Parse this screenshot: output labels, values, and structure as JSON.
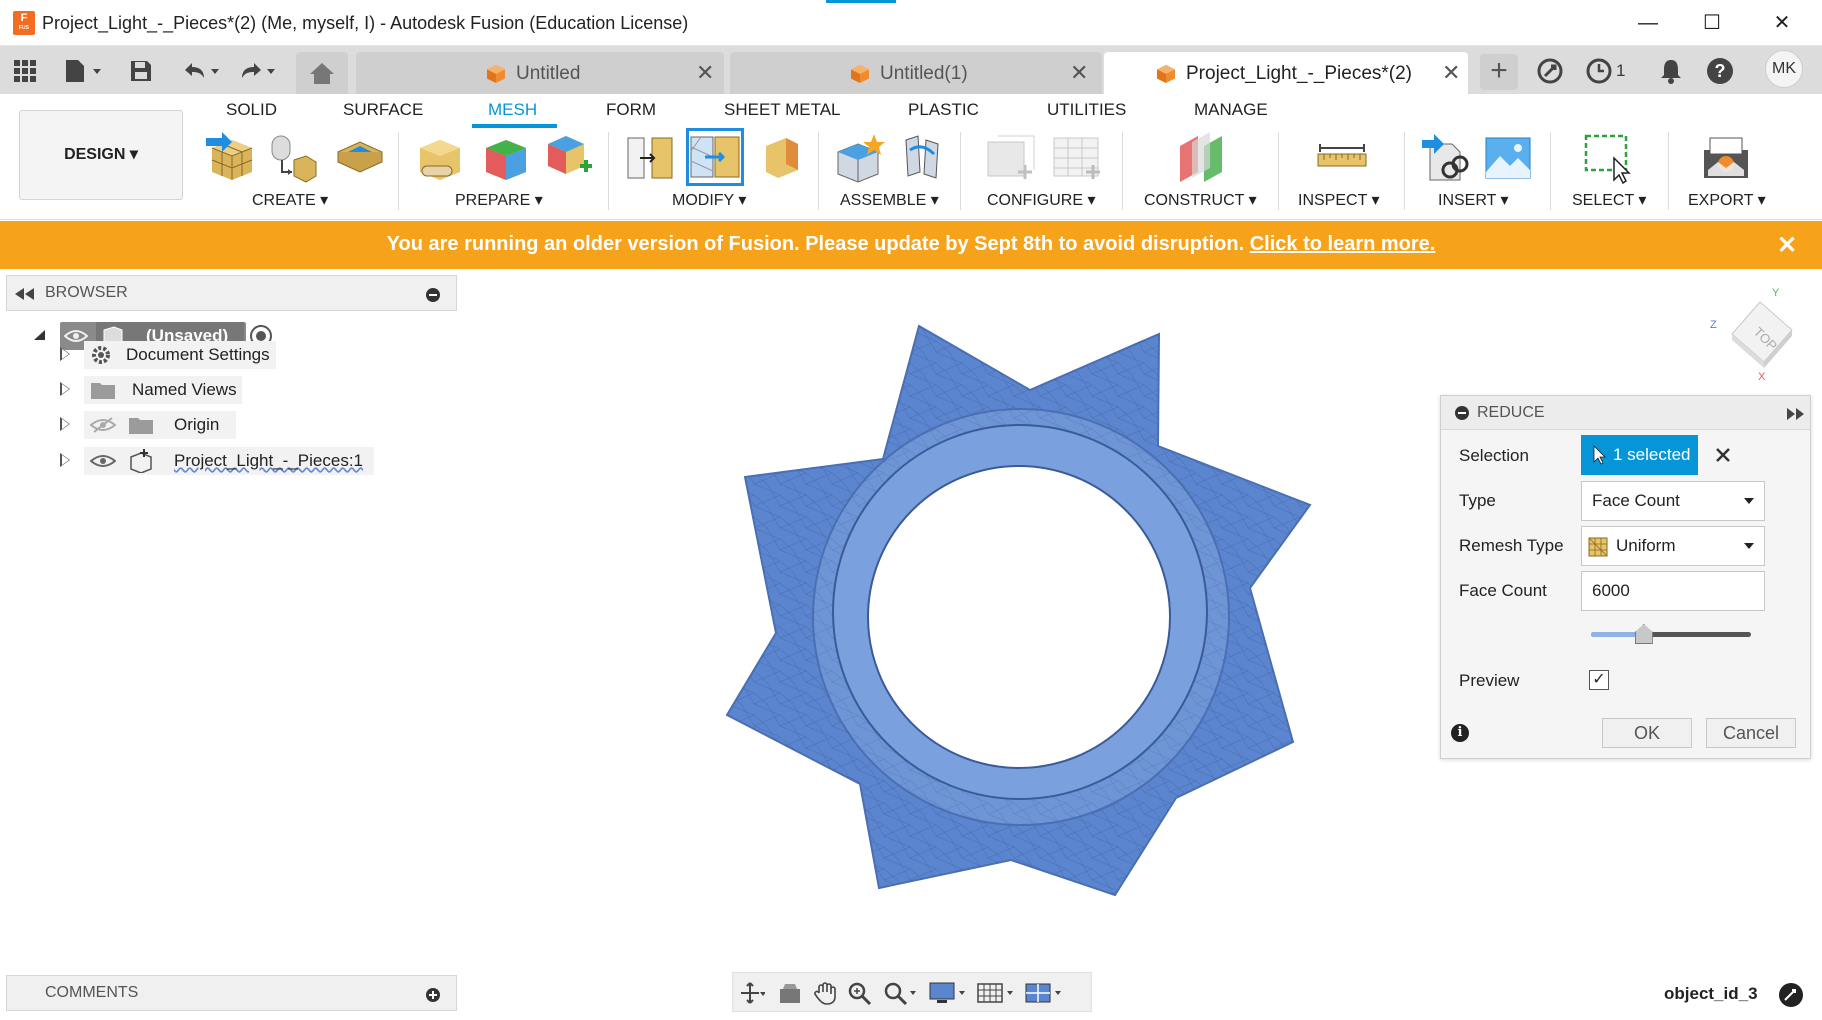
{
  "window": {
    "title": "Project_Light_-_Pieces*(2) (Me, myself, I) - Autodesk Fusion (Education License)",
    "app_icon_letter": "F",
    "app_icon_sub": "FUS",
    "minimize": "—",
    "maximize": "☐",
    "close": "✕"
  },
  "tabs": [
    {
      "label": "Untitled",
      "close": "✕",
      "active": false
    },
    {
      "label": "Untitled(1)",
      "close": "✕",
      "active": false
    },
    {
      "label": "Project_Light_-_Pieces*(2)",
      "close": "✕",
      "active": true
    }
  ],
  "tabbar": {
    "add_tab": "+",
    "job_count": "1",
    "avatar": "MK",
    "help": "?"
  },
  "ribbon": {
    "workspace": "DESIGN ▾",
    "tabs": [
      "SOLID",
      "SURFACE",
      "MESH",
      "FORM",
      "SHEET METAL",
      "PLASTIC",
      "UTILITIES",
      "MANAGE"
    ],
    "active_tab": "MESH",
    "groups": {
      "create": "CREATE ▾",
      "prepare": "PREPARE ▾",
      "modify": "MODIFY ▾",
      "assemble": "ASSEMBLE ▾",
      "configure": "CONFIGURE ▾",
      "construct": "CONSTRUCT ▾",
      "inspect": "INSPECT ▾",
      "insert": "INSERT ▾",
      "select": "SELECT ▾",
      "export": "EXPORT ▾"
    }
  },
  "banner": {
    "message": "You are running an older version of Fusion. Please update by Sept 8th to avoid disruption.",
    "link": "Click to learn more.",
    "close": "✕",
    "color": "#f7a21b"
  },
  "browser": {
    "title": "BROWSER",
    "root": "(Unsaved)",
    "items": [
      {
        "label": "Document Settings"
      },
      {
        "label": "Named Views"
      },
      {
        "label": "Origin"
      },
      {
        "label": "Project_Light_-_Pieces:1"
      }
    ]
  },
  "comments": {
    "title": "COMMENTS"
  },
  "viewcube": {
    "face": "TOP",
    "axis_y": "Y",
    "axis_z": "Z",
    "axis_x": "X"
  },
  "reduce_dialog": {
    "title": "REDUCE",
    "selection_label": "Selection",
    "selection_value": "1 selected",
    "type_label": "Type",
    "type_value": "Face Count",
    "remesh_label": "Remesh Type",
    "remesh_value": "Uniform",
    "facecount_label": "Face Count",
    "facecount_value": "6000",
    "slider_fraction": 0.33,
    "preview_label": "Preview",
    "preview_checked": true,
    "ok": "OK",
    "cancel": "Cancel"
  },
  "status": {
    "object_id": "object_id_3"
  },
  "colors": {
    "accent": "#0696d7",
    "mesh": "#5b86cf",
    "banner": "#f7a21b"
  }
}
